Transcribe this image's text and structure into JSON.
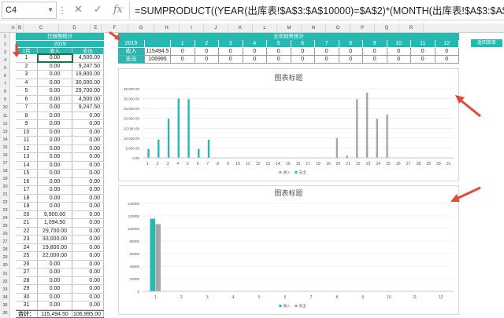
{
  "formula_bar": {
    "name_box": "C4",
    "formula": "=SUMPRODUCT((YEAR(出库表!$A$3:$A$10000)=$A$2)*(MONTH(出库表!$A$3:$A$10000)=$A$3)*(DAY(E"
  },
  "column_headers": [
    "A",
    "B",
    "C",
    "D",
    "E",
    "F",
    "G",
    "H",
    "I",
    "J",
    "K",
    "L",
    "M",
    "N",
    "O",
    "P",
    "Q",
    "R"
  ],
  "row_headers": [
    "1",
    "2",
    "3",
    "4",
    "5",
    "6",
    "7",
    "8",
    "9",
    "10",
    "11",
    "12",
    "13",
    "14",
    "15",
    "16",
    "17",
    "18",
    "19",
    "20",
    "21",
    "22",
    "23",
    "24",
    "25",
    "26",
    "27",
    "28",
    "29",
    "30",
    "31",
    "32",
    "33",
    "34",
    "35",
    "36"
  ],
  "daily_table": {
    "title": "日报图统计",
    "year": "2019",
    "header": [
      "1月",
      "收入",
      "支出"
    ],
    "rows": [
      {
        "day": "1",
        "income": "0.00",
        "expense": "4,500.00"
      },
      {
        "day": "2",
        "income": "0.00",
        "expense": "9,247.50"
      },
      {
        "day": "3",
        "income": "0.00",
        "expense": "19,800.00"
      },
      {
        "day": "4",
        "income": "0.00",
        "expense": "30,000.00"
      },
      {
        "day": "5",
        "income": "0.00",
        "expense": "29,700.00"
      },
      {
        "day": "6",
        "income": "0.00",
        "expense": "4,500.00"
      },
      {
        "day": "7",
        "income": "0.00",
        "expense": "9,247.50"
      },
      {
        "day": "8",
        "income": "0.00",
        "expense": "0.00"
      },
      {
        "day": "9",
        "income": "0.00",
        "expense": "0.00"
      },
      {
        "day": "10",
        "income": "0.00",
        "expense": "0.00"
      },
      {
        "day": "11",
        "income": "0.00",
        "expense": "0.00"
      },
      {
        "day": "12",
        "income": "0.00",
        "expense": "0.00"
      },
      {
        "day": "13",
        "income": "0.00",
        "expense": "0.00"
      },
      {
        "day": "14",
        "income": "0.00",
        "expense": "0.00"
      },
      {
        "day": "15",
        "income": "0.00",
        "expense": "0.00"
      },
      {
        "day": "16",
        "income": "0.00",
        "expense": "0.00"
      },
      {
        "day": "17",
        "income": "0.00",
        "expense": "0.00"
      },
      {
        "day": "18",
        "income": "0.00",
        "expense": "0.00"
      },
      {
        "day": "19",
        "income": "0.00",
        "expense": "0.00"
      },
      {
        "day": "20",
        "income": "9,900.00",
        "expense": "0.00"
      },
      {
        "day": "21",
        "income": "1,094.50",
        "expense": "0.00"
      },
      {
        "day": "22",
        "income": "29,700.00",
        "expense": "0.00"
      },
      {
        "day": "23",
        "income": "33,000.00",
        "expense": "0.00"
      },
      {
        "day": "24",
        "income": "19,800.00",
        "expense": "0.00"
      },
      {
        "day": "25",
        "income": "22,000.00",
        "expense": "0.00"
      },
      {
        "day": "26",
        "income": "0.00",
        "expense": "0.00"
      },
      {
        "day": "27",
        "income": "0.00",
        "expense": "0.00"
      },
      {
        "day": "28",
        "income": "0.00",
        "expense": "0.00"
      },
      {
        "day": "29",
        "income": "0.00",
        "expense": "0.00"
      },
      {
        "day": "30",
        "income": "0.00",
        "expense": "0.00"
      },
      {
        "day": "31",
        "income": "0.00",
        "expense": "0.00"
      }
    ],
    "total": {
      "label": "合计：",
      "income": "115,494.50",
      "expense": "106,995.00"
    }
  },
  "monthly_table": {
    "title": "全年财务统计",
    "year": "2019",
    "months": [
      "1",
      "2",
      "3",
      "4",
      "5",
      "6",
      "7",
      "8",
      "9",
      "10",
      "11",
      "12"
    ],
    "rows": [
      {
        "label": "收入",
        "total": "115494.5",
        "values": [
          "0",
          "0",
          "0",
          "0",
          "0",
          "0",
          "0",
          "0",
          "0",
          "0",
          "0",
          "0"
        ]
      },
      {
        "label": "支出",
        "total": "106995",
        "values": [
          "0",
          "0",
          "0",
          "0",
          "0",
          "0",
          "0",
          "0",
          "0",
          "0",
          "0",
          "0"
        ]
      }
    ]
  },
  "button": {
    "label": "返回菜单"
  },
  "colors": {
    "teal": "#26b9b2",
    "gray": "#a5a5a5",
    "arrow": "#e8453c"
  },
  "chart_data": [
    {
      "type": "bar",
      "title": "图表标题",
      "categories": [
        "1",
        "2",
        "3",
        "4",
        "5",
        "6",
        "7",
        "8",
        "9",
        "10",
        "11",
        "12",
        "13",
        "14",
        "15",
        "16",
        "17",
        "18",
        "19",
        "20",
        "21",
        "22",
        "23",
        "24",
        "25",
        "26",
        "27",
        "28",
        "29",
        "30",
        "31"
      ],
      "series": [
        {
          "name": "收入",
          "values": [
            0,
            0,
            0,
            0,
            0,
            0,
            0,
            0,
            0,
            0,
            0,
            0,
            0,
            0,
            0,
            0,
            0,
            0,
            0,
            9900,
            1094.5,
            29700,
            33000,
            19800,
            22000,
            0,
            0,
            0,
            0,
            0,
            0
          ]
        },
        {
          "name": "支出",
          "values": [
            4500,
            9247.5,
            19800,
            30000,
            29700,
            4500,
            9247.5,
            0,
            0,
            0,
            0,
            0,
            0,
            0,
            0,
            0,
            0,
            0,
            0,
            0,
            0,
            0,
            0,
            0,
            0,
            0,
            0,
            0,
            0,
            0,
            0
          ]
        }
      ],
      "ylim": [
        0,
        35000
      ],
      "yticks": [
        "0.00",
        "5,000.00",
        "10,000.00",
        "15,000.00",
        "20,000.00",
        "25,000.00",
        "30,000.00",
        "35,000.00"
      ],
      "legend": "bottom"
    },
    {
      "type": "bar",
      "title": "图表标题",
      "categories": [
        "1",
        "2",
        "3",
        "4",
        "5",
        "6",
        "7",
        "8",
        "9",
        "10",
        "11",
        "12"
      ],
      "series": [
        {
          "name": "收入",
          "values": [
            115494.5,
            0,
            0,
            0,
            0,
            0,
            0,
            0,
            0,
            0,
            0,
            0
          ]
        },
        {
          "name": "支出",
          "values": [
            106995,
            0,
            0,
            0,
            0,
            0,
            0,
            0,
            0,
            0,
            0,
            0
          ]
        }
      ],
      "ylim": [
        0,
        140000
      ],
      "yticks": [
        "0",
        "20000",
        "40000",
        "60000",
        "80000",
        "100000",
        "120000",
        "140000"
      ],
      "legend": "bottom"
    }
  ]
}
